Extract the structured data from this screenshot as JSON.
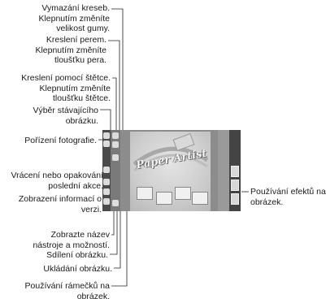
{
  "callouts_left": [
    {
      "id": "eraser",
      "text": "Vymazání kreseb.\nKlepnutím změníte\nvelikost gumy."
    },
    {
      "id": "pen",
      "text": "Kreslení perem.\nKlepnutím změníte\ntloušťku pera."
    },
    {
      "id": "brush",
      "text": "Kreslení pomocí štětce.\nKlepnutím změníte\ntloušťku štětce."
    },
    {
      "id": "select-image",
      "text": "Výběr stávajícího\nobrázku."
    },
    {
      "id": "take-photo",
      "text": "Pořízení fotografie."
    },
    {
      "id": "undo-redo",
      "text": "Vrácení nebo opakování\nposlední akce."
    },
    {
      "id": "version-info",
      "text": "Zobrazení informací o\nverzi."
    },
    {
      "id": "tool-name",
      "text": "Zobrazte název\nnástroje a možností."
    },
    {
      "id": "share",
      "text": "Sdílení obrázku."
    },
    {
      "id": "save",
      "text": "Ukládání obrázku."
    },
    {
      "id": "frames",
      "text": "Používání rámečků na\nobrázek."
    }
  ],
  "callout_right": {
    "id": "effects",
    "text": "Používání efektů na\nobrázek."
  },
  "canvas": {
    "title_art": "Paper Artist"
  }
}
